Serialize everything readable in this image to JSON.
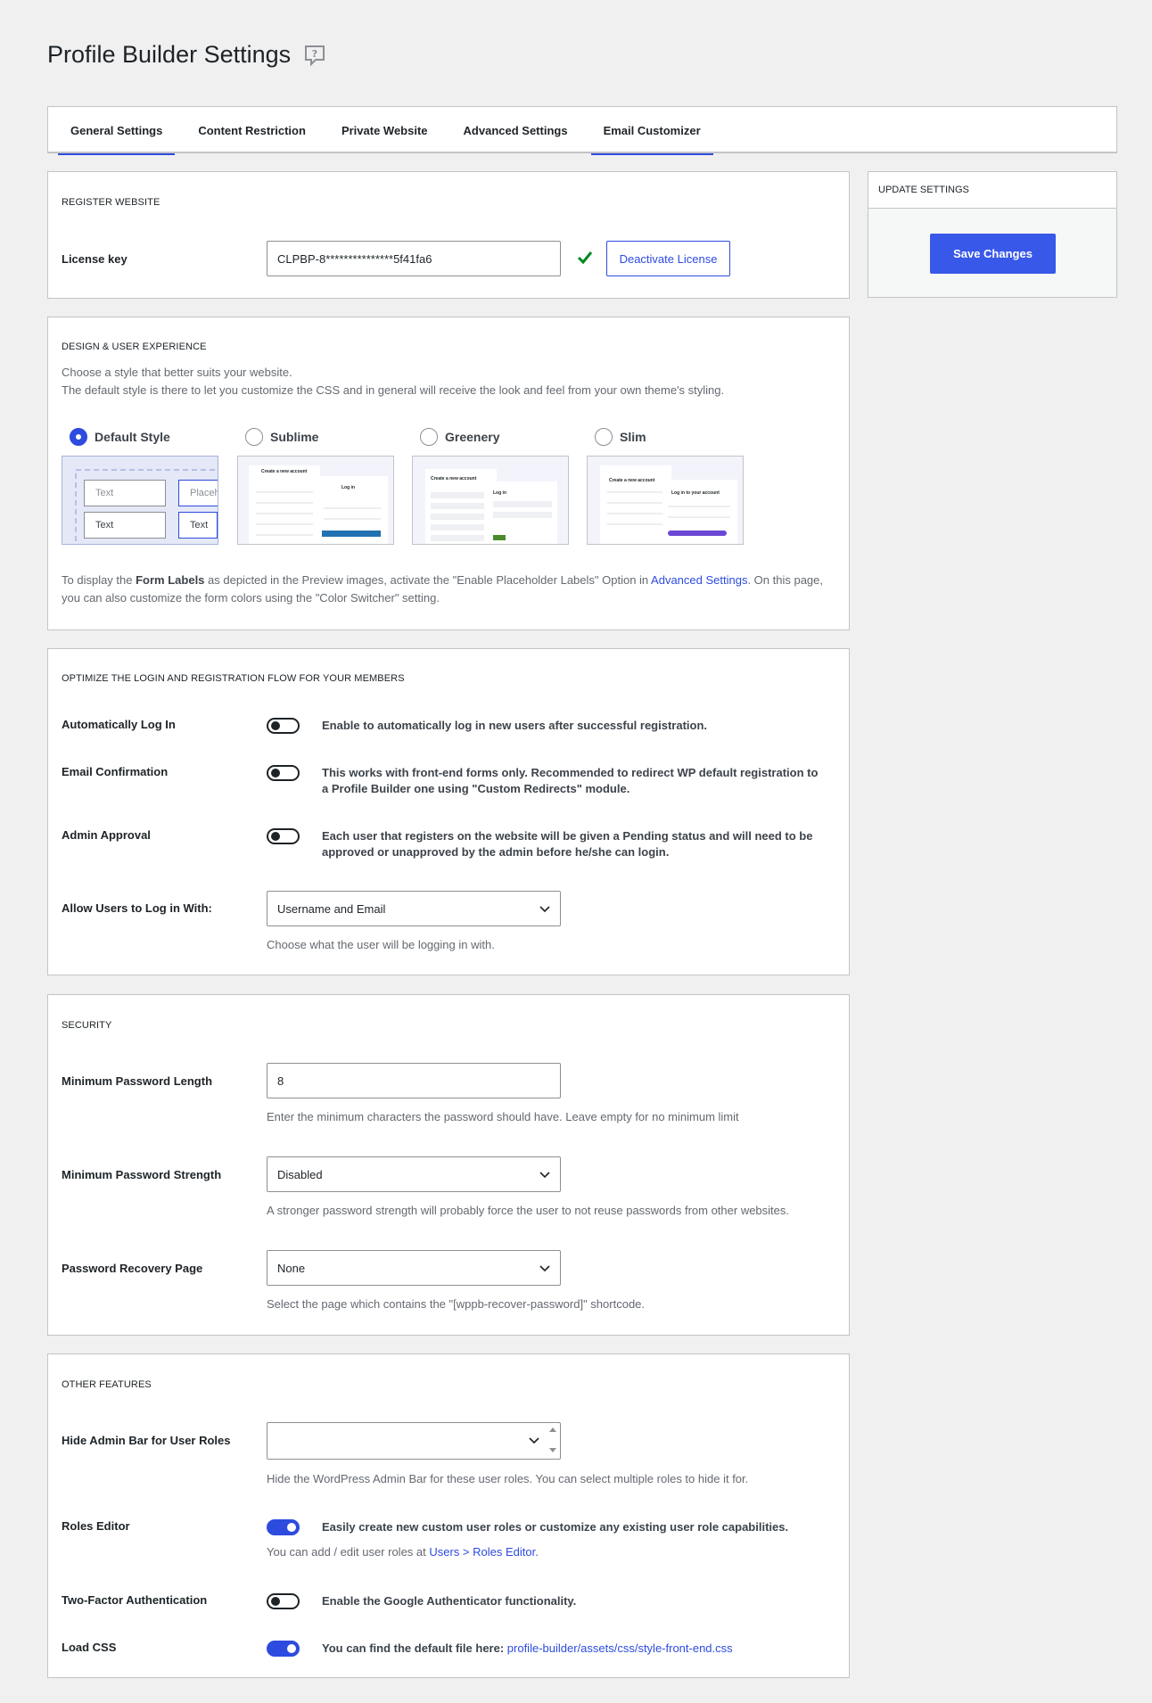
{
  "page": {
    "title": "Profile Builder Settings",
    "help_icon": "speech-bubble-question-icon"
  },
  "tabs": [
    {
      "label": "General Settings",
      "active": true
    },
    {
      "label": "Content Restriction",
      "active": false
    },
    {
      "label": "Private Website",
      "active": false
    },
    {
      "label": "Advanced Settings",
      "active": false
    },
    {
      "label": "Email Customizer",
      "active": true
    }
  ],
  "register": {
    "title": "REGISTER WEBSITE",
    "license_label": "License key",
    "license_value": "CLPBP-8***************5f41fa6",
    "deactivate_label": "Deactivate License"
  },
  "update": {
    "title": "UPDATE SETTINGS",
    "save_label": "Save Changes"
  },
  "design": {
    "title": "DESIGN & USER EXPERIENCE",
    "intro_1": "Choose a style that better suits your website.",
    "intro_2": "The default style is there to let you customize the CSS and in general will receive the look and feel from your own theme's styling.",
    "styles": [
      {
        "label": "Default Style",
        "selected": true
      },
      {
        "label": "Sublime",
        "selected": false
      },
      {
        "label": "Greenery",
        "selected": false
      },
      {
        "label": "Slim",
        "selected": false
      }
    ],
    "preview_default": {
      "field_1": "Text",
      "field_2": "Placeh",
      "field_3": "Text",
      "field_4": "Text"
    },
    "preview_sublime": {
      "heading": "Create a new account",
      "login": "Log in"
    },
    "preview_greenery": {
      "heading": "Create a new account",
      "login": "Log in"
    },
    "preview_slim": {
      "heading": "Create a new account",
      "login": "Log in to your account"
    },
    "note_pre": "To display the ",
    "note_bold": "Form Labels",
    "note_mid": " as depicted in the Preview images, activate the \"Enable Placeholder Labels\" Option in ",
    "note_link": "Advanced Settings",
    "note_post": ". On this page, you can also customize the form colors using the \"Color Switcher\" setting."
  },
  "optimize": {
    "title": "OPTIMIZE THE LOGIN AND REGISTRATION FLOW FOR YOUR MEMBERS",
    "auto_login_label": "Automatically Log In",
    "auto_login_desc": "Enable to automatically log in new users after successful registration.",
    "email_conf_label": "Email Confirmation",
    "email_conf_desc": "This works with front-end forms only. Recommended to redirect WP default registration to a Profile Builder one using \"Custom Redirects\" module.",
    "admin_approval_label": "Admin Approval",
    "admin_approval_desc": "Each user that registers on the website will be given a Pending status and will need to be approved or unapproved by the admin before he/she can login.",
    "login_with_label": "Allow Users to Log in With:",
    "login_with_value": "Username and Email",
    "login_with_hint": "Choose what the user will be logging in with."
  },
  "security": {
    "title": "SECURITY",
    "min_len_label": "Minimum Password Length",
    "min_len_value": "8",
    "min_len_hint": "Enter the minimum characters the password should have. Leave empty for no minimum limit",
    "min_strength_label": "Minimum Password Strength",
    "min_strength_value": "Disabled",
    "min_strength_hint": "A stronger password strength will probably force the user to not reuse passwords from other websites.",
    "recovery_label": "Password Recovery Page",
    "recovery_value": "None",
    "recovery_hint": "Select the page which contains the \"[wppb-recover-password]\" shortcode."
  },
  "other": {
    "title": "OTHER FEATURES",
    "hide_bar_label": "Hide Admin Bar for User Roles",
    "hide_bar_value": "",
    "hide_bar_hint": "Hide the WordPress Admin Bar for these user roles. You can select multiple roles to hide it for.",
    "roles_label": "Roles Editor",
    "roles_desc": "Easily create new custom user roles or customize any existing user role capabilities.",
    "roles_hint_pre": "You can add / edit user roles at ",
    "roles_hint_link": "Users > Roles Editor.",
    "twofa_label": "Two-Factor Authentication",
    "twofa_desc": "Enable the Google Authenticator functionality.",
    "loadcss_label": "Load CSS",
    "loadcss_desc": "You can find the default file here: ",
    "loadcss_link": "profile-builder/assets/css/style-front-end.css"
  },
  "colors": {
    "accent": "#2d4bdf",
    "save_button": "#3858e9",
    "check": "#008a20"
  }
}
